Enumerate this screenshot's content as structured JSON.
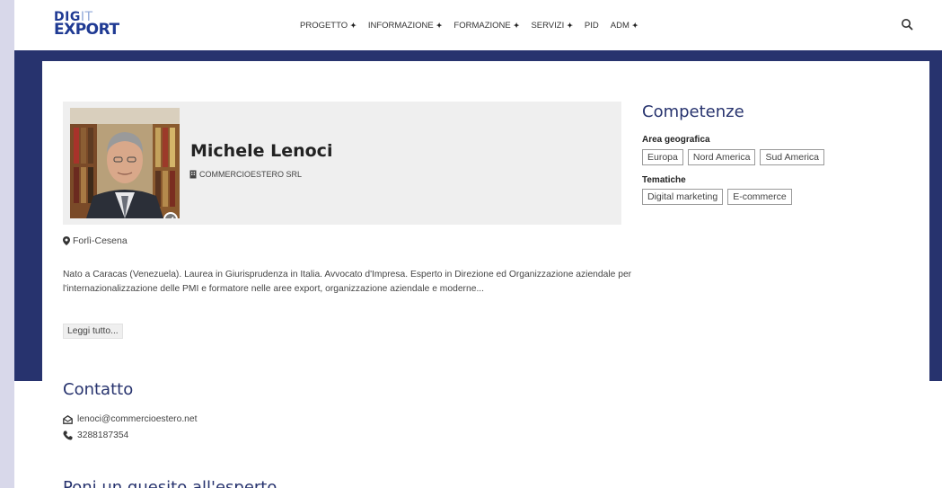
{
  "logo": {
    "top_part1": "DIG",
    "top_part2": "IT",
    "bottom": "EXPORT"
  },
  "nav": {
    "items": [
      {
        "label": "PROGETTO",
        "has_dropdown": true
      },
      {
        "label": "INFORMAZIONE",
        "has_dropdown": true
      },
      {
        "label": "FORMAZIONE",
        "has_dropdown": true
      },
      {
        "label": "SERVIZI",
        "has_dropdown": true
      },
      {
        "label": "PID",
        "has_dropdown": false
      },
      {
        "label": "ADM",
        "has_dropdown": true
      }
    ],
    "dropdown_glyph": "✦",
    "search_icon": "search-icon"
  },
  "profile": {
    "name": "Michele Lenoci",
    "company": "COMMERCIOESTERO SRL",
    "company_icon": "building-icon",
    "location": "Forlì-Cesena",
    "location_icon": "map-pin-icon",
    "verified_icon": "check-icon",
    "bio": "Nato a Caracas (Venezuela). Laurea in Giurisprudenza in Italia. Avvocato d'Impresa. Esperto in Direzione ed Organizzazione aziendale per l'internazionalizzazione delle PMI e formatore nelle aree export, organizzazione aziendale e moderne...",
    "read_more": "Leggi tutto..."
  },
  "competenze": {
    "title": "Competenze",
    "groups": [
      {
        "label": "Area geografica",
        "tags": [
          "Europa",
          "Nord America",
          "Sud America"
        ]
      },
      {
        "label": "Tematiche",
        "tags": [
          "Digital marketing",
          "E-commerce"
        ]
      }
    ]
  },
  "contact": {
    "title": "Contatto",
    "email": "lenoci@commercioestero.net",
    "phone": "3288187354",
    "email_icon": "envelope-icon",
    "phone_icon": "phone-icon"
  },
  "question": {
    "title": "Poni un quesito all'esperto"
  },
  "colors": {
    "brand": "#27336e",
    "logo_light": "#8fa8d8",
    "panel": "#efefef"
  }
}
